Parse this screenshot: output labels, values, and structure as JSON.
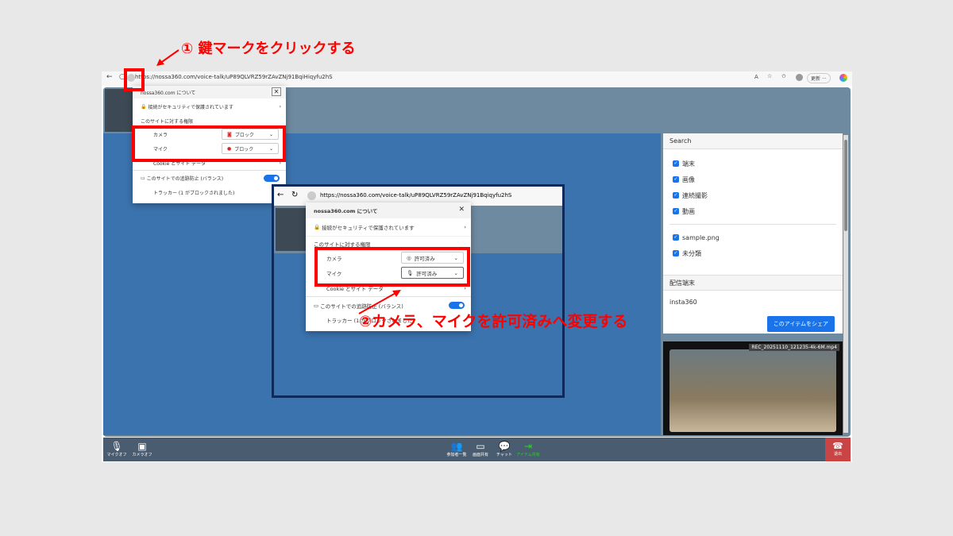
{
  "annotations": {
    "step1": "① 鍵マークをクリックする",
    "step2": "②カメラ、マイクを許可済みへ変更する"
  },
  "browser": {
    "url": "https://nossa360.com/voice-talk/uP89QLVRZ59rZAvZNj91BqiHiqyfu2hS",
    "update_label": "更新",
    "more": "···"
  },
  "popup_before": {
    "title": "nossa360.com について",
    "secure": "接続がセキュリティで保護されています",
    "permissions": "このサイトに対する権限",
    "camera_label": "カメラ",
    "camera_value": "ブロック",
    "mic_label": "マイク",
    "mic_value": "ブロック",
    "cookie": "Cookie とサイト データ",
    "tracking": "このサイトでの追跡防止 (バランス)",
    "trackers": "トラッカー (1 がブロックされました)"
  },
  "popup_after": {
    "url": "https://nossa360.com/voice-talk/uP89QLVRZ59rZAvZNj91Bqiqyfu2hS",
    "title": "nossa360.com について",
    "secure": "接続がセキュリティで保護されています",
    "permissions": "このサイトに対する権限",
    "camera_label": "カメラ",
    "camera_value": "許可済み",
    "mic_label": "マイク",
    "mic_value": "許可済み",
    "cookie": "Cookie とサイト データ",
    "tracking": "このサイトでの追跡防止 (バランス)",
    "trackers": "トラッカー (1 がブロックされました)"
  },
  "sidebar": {
    "search_title": "Search",
    "filters": [
      "端末",
      "画像",
      "連続撮影",
      "動画"
    ],
    "files": [
      "sample.png",
      "未分類"
    ],
    "device_title": "配信端末",
    "device": "insta360",
    "share_button": "このアイテムをシェア",
    "video_label": "REC_20251110_121235-4k-6M.mp4"
  },
  "toolbar": {
    "mic": "マイクオフ",
    "camera": "カメラオフ",
    "participants": "参加者一覧",
    "screen": "画面共有",
    "chat": "チャット",
    "item_share": "アイテム共有",
    "exit": "退出"
  }
}
